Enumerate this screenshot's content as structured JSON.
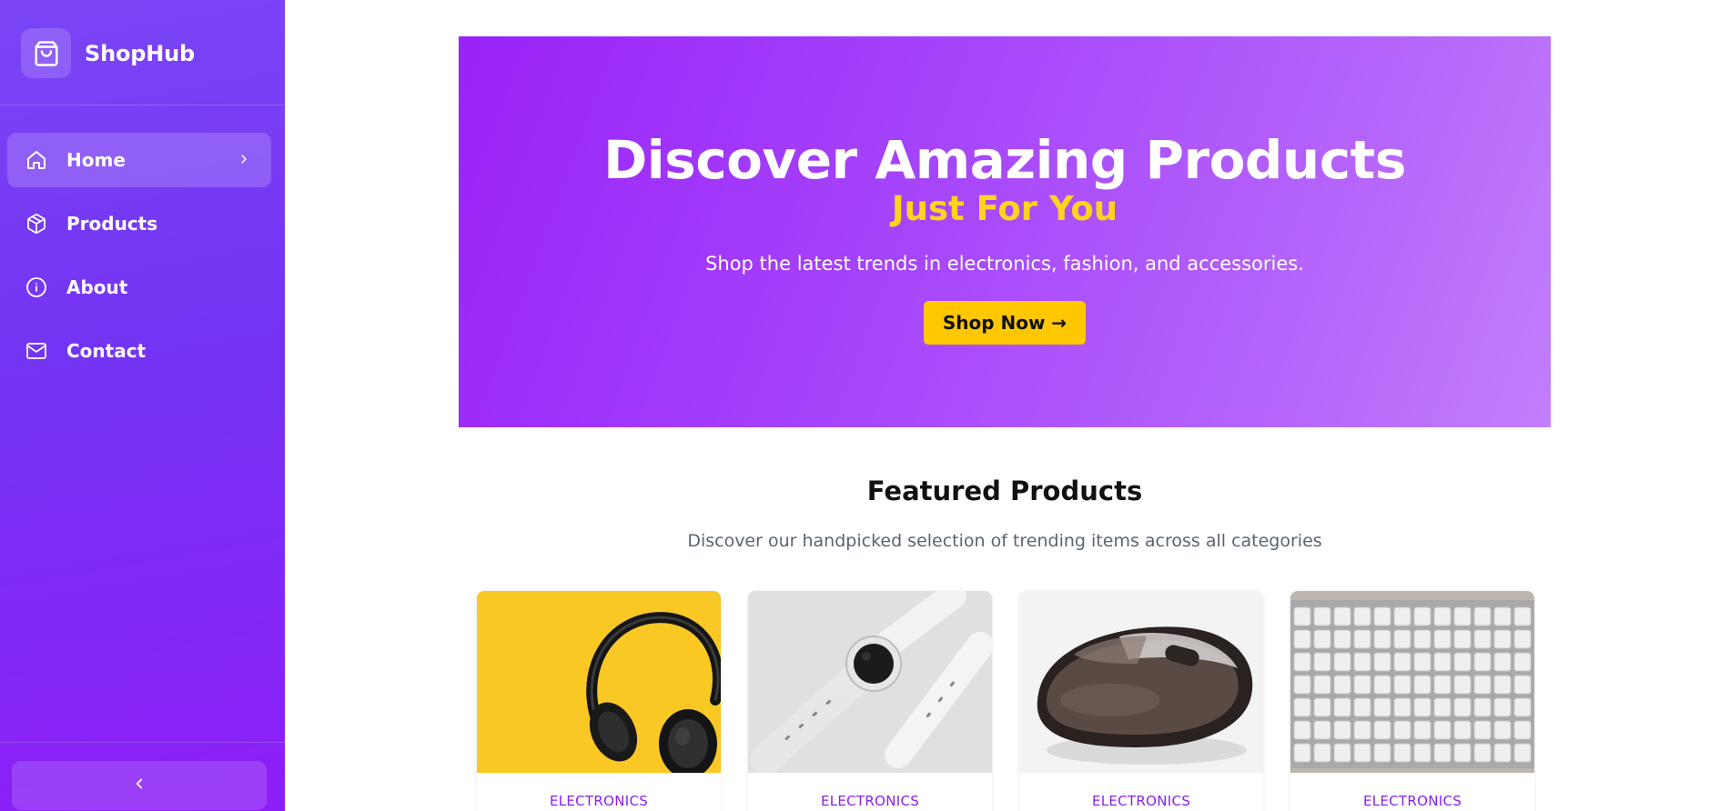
{
  "brand": {
    "name": "ShopHub",
    "icon": "shopping-bag-icon"
  },
  "sidebar": {
    "items": [
      {
        "label": "Home",
        "icon": "home-icon",
        "active": true
      },
      {
        "label": "Products",
        "icon": "box-icon",
        "active": false
      },
      {
        "label": "About",
        "icon": "info-icon",
        "active": false
      },
      {
        "label": "Contact",
        "icon": "mail-icon",
        "active": false
      }
    ],
    "collapse_icon": "chevron-left-icon"
  },
  "hero": {
    "title": "Discover Amazing Products",
    "subtitle": "Just For You",
    "description": "Shop the latest trends in electronics, fashion, and accessories.",
    "cta_label": "Shop Now →"
  },
  "featured": {
    "title": "Featured Products",
    "subtitle": "Discover our handpicked selection of trending items across all categories",
    "products": [
      {
        "category": "ELECTRONICS",
        "image": "headphones"
      },
      {
        "category": "ELECTRONICS",
        "image": "smartwatch"
      },
      {
        "category": "ELECTRONICS",
        "image": "wireless-mouse"
      },
      {
        "category": "ELECTRONICS",
        "image": "keyboard"
      }
    ]
  },
  "colors": {
    "accent_purple": "#8a1ff0",
    "cta_yellow": "#ffc700",
    "subtitle_yellow": "#ffd21f"
  }
}
